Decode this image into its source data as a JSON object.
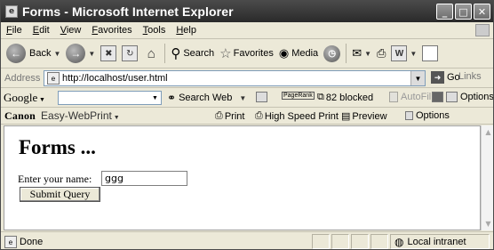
{
  "window": {
    "title": "Forms - Microsoft Internet Explorer"
  },
  "menu": [
    "File",
    "Edit",
    "View",
    "Favorites",
    "Tools",
    "Help"
  ],
  "toolbar": {
    "back": "Back",
    "search": "Search",
    "favorites": "Favorites",
    "media": "Media"
  },
  "address": {
    "label": "Address",
    "url": "http://localhost/user.html",
    "go": "Go",
    "links": "Links"
  },
  "google": {
    "logo": "Google",
    "search_web": "Search Web",
    "pagerank": "PageRank",
    "blocked": "82 blocked",
    "autofill": "AutoFill",
    "options": "Options"
  },
  "canon": {
    "logo": "Canon",
    "app": "Easy-WebPrint",
    "print": "Print",
    "high_speed_print": "High Speed Print",
    "preview": "Preview",
    "options": "Options"
  },
  "page": {
    "heading": "Forms ...",
    "name_label": "Enter your name:",
    "name_value": "ggg",
    "submit_label": "Submit Query"
  },
  "status": {
    "left": "Done",
    "zone": "Local intranet"
  }
}
